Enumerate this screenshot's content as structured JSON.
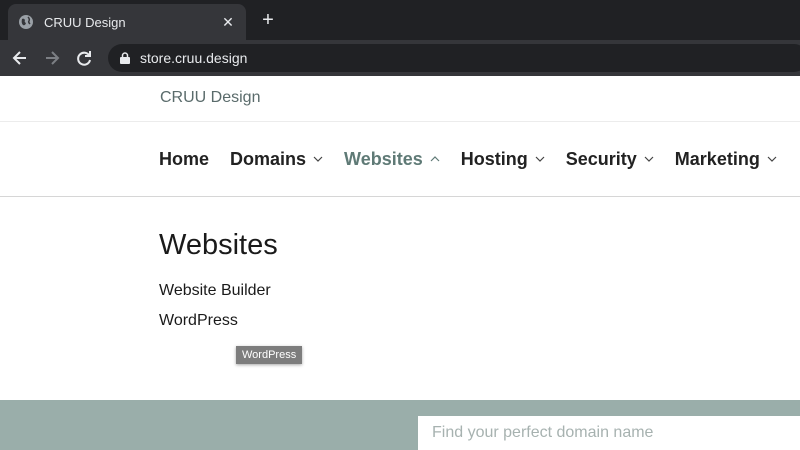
{
  "browser": {
    "tab_title": "CRUU Design",
    "tab_icon": "globe-icon",
    "url": "store.cruu.design"
  },
  "site": {
    "title": "CRUU Design"
  },
  "nav": {
    "items": [
      {
        "label": "Home",
        "has_menu": false,
        "active": false
      },
      {
        "label": "Domains",
        "has_menu": true,
        "active": false
      },
      {
        "label": "Websites",
        "has_menu": true,
        "active": true
      },
      {
        "label": "Hosting",
        "has_menu": true,
        "active": false
      },
      {
        "label": "Security",
        "has_menu": true,
        "active": false
      },
      {
        "label": "Marketing",
        "has_menu": true,
        "active": false
      }
    ]
  },
  "dropdown": {
    "heading": "Websites",
    "links": [
      "Website Builder",
      "WordPress"
    ],
    "tooltip": "WordPress"
  },
  "search": {
    "placeholder": "Find your perfect domain name"
  },
  "colors": {
    "accent": "#5f7a76",
    "band": "#9aaeaa"
  }
}
